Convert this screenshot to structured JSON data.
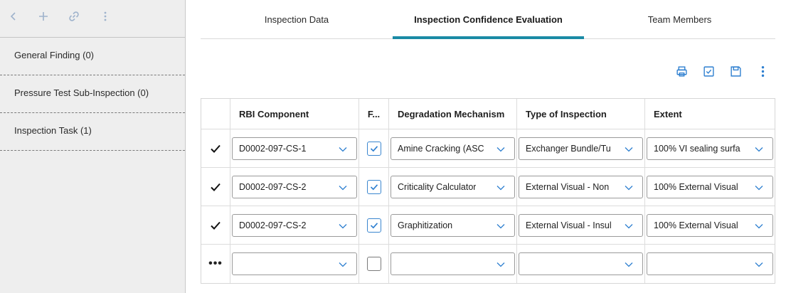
{
  "sidebar": {
    "items": [
      {
        "label": "General Finding (0)"
      },
      {
        "label": "Pressure Test Sub-Inspection (0)"
      },
      {
        "label": "Inspection Task (1)"
      }
    ]
  },
  "tabs": [
    {
      "label": "Inspection Data"
    },
    {
      "label": "Inspection Confidence Evaluation",
      "active": true
    },
    {
      "label": "Team Members"
    }
  ],
  "grid": {
    "headers": [
      "RBI Component",
      "F...",
      "Degradation Mechanism",
      "Type of Inspection",
      "Extent"
    ],
    "rows": [
      {
        "component": "D0002-097-CS-1",
        "flag": true,
        "mechanism": "Amine Cracking (ASC",
        "inspection": "Exchanger Bundle/Tu",
        "extent": "100% VI sealing surfa"
      },
      {
        "component": "D0002-097-CS-2",
        "flag": true,
        "mechanism": "Criticality Calculator",
        "inspection": "External Visual - Non",
        "extent": "100% External Visual"
      },
      {
        "component": "D0002-097-CS-2",
        "flag": true,
        "mechanism": "Graphitization",
        "inspection": "External Visual - Insul",
        "extent": "100% External Visual"
      },
      {
        "component": "",
        "flag": false,
        "mechanism": "",
        "inspection": "",
        "extent": ""
      }
    ],
    "new_row_marker": "•••"
  },
  "colors": {
    "accent": "#1a8aa5",
    "icon_blue": "#2d7fd0"
  }
}
